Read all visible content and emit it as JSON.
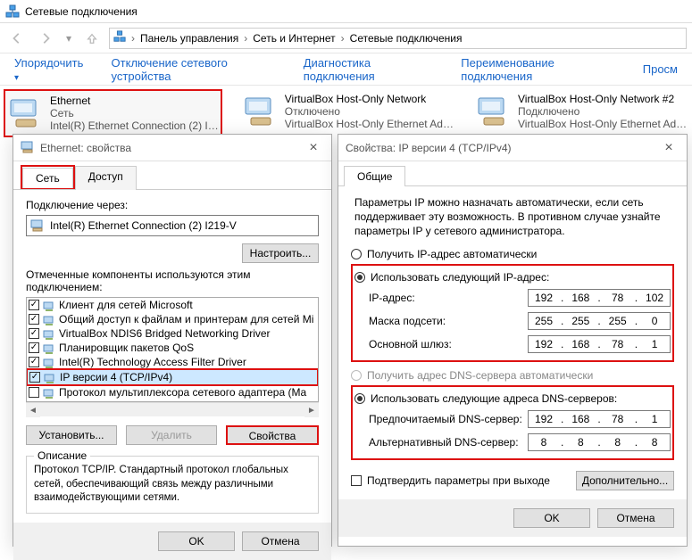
{
  "explorer": {
    "title": "Сетевые подключения",
    "breadcrumbs": [
      "Панель управления",
      "Сеть и Интернет",
      "Сетевые подключения"
    ],
    "toolbar": {
      "organize": "Упорядочить",
      "disable": "Отключение сетевого устройства",
      "diagnose": "Диагностика подключения",
      "rename": "Переименование подключения",
      "view": "Просм"
    },
    "items": [
      {
        "title": "Ethernet",
        "line1": "Сеть",
        "line2": "Intel(R) Ethernet Connection (2) I…"
      },
      {
        "title": "VirtualBox Host-Only Network",
        "line1": "Отключено",
        "line2": "VirtualBox Host-Only Ethernet Ad…"
      },
      {
        "title": "VirtualBox Host-Only Network #2",
        "line1": "Подключено",
        "line2": "VirtualBox Host-Only Ethernet Ad…"
      }
    ]
  },
  "propsDlg": {
    "title": "Ethernet: свойства",
    "tabs": {
      "network": "Сеть",
      "access": "Доступ"
    },
    "connectUsing": "Подключение через:",
    "adapter": "Intel(R) Ethernet Connection (2) I219-V",
    "configure": "Настроить...",
    "componentsHeader": "Отмеченные компоненты используются этим подключением:",
    "components": [
      {
        "checked": true,
        "label": "Клиент для сетей Microsoft"
      },
      {
        "checked": true,
        "label": "Общий доступ к файлам и принтерам для сетей Mi"
      },
      {
        "checked": true,
        "label": "VirtualBox NDIS6 Bridged Networking Driver"
      },
      {
        "checked": true,
        "label": "Планировщик пакетов QoS"
      },
      {
        "checked": true,
        "label": "Intel(R) Technology Access Filter Driver"
      },
      {
        "checked": true,
        "label": "IP версии 4 (TCP/IPv4)",
        "selected": true
      },
      {
        "checked": false,
        "label": "Протокол мультиплексора сетевого адаптера (Ma"
      }
    ],
    "install": "Установить...",
    "uninstall": "Удалить",
    "properties": "Свойства",
    "descHeader": "Описание",
    "descText": "Протокол TCP/IP. Стандартный протокол глобальных сетей, обеспечивающий связь между различными взаимодействующими сетями.",
    "ok": "OK",
    "cancel": "Отмена"
  },
  "ipv4Dlg": {
    "title": "Свойства: IP версии 4 (TCP/IPv4)",
    "tab": "Общие",
    "intro": "Параметры IP можно назначать автоматически, если сеть поддерживает эту возможность. В противном случае узнайте параметры IP у сетевого администратора.",
    "radio_auto_ip": "Получить IP-адрес автоматически",
    "radio_manual_ip": "Использовать следующий IP-адрес:",
    "ip_label": "IP-адрес:",
    "ip": [
      "192",
      "168",
      "78",
      "102"
    ],
    "mask_label": "Маска подсети:",
    "mask": [
      "255",
      "255",
      "255",
      "0"
    ],
    "gw_label": "Основной шлюз:",
    "gw": [
      "192",
      "168",
      "78",
      "1"
    ],
    "radio_auto_dns": "Получить адрес DNS-сервера автоматически",
    "radio_manual_dns": "Использовать следующие адреса DNS-серверов:",
    "dns1_label": "Предпочитаемый DNS-сервер:",
    "dns1": [
      "192",
      "168",
      "78",
      "1"
    ],
    "dns2_label": "Альтернативный DNS-сервер:",
    "dns2": [
      "8",
      "8",
      "8",
      "8"
    ],
    "validate": "Подтвердить параметры при выходе",
    "advanced": "Дополнительно...",
    "ok": "OK",
    "cancel": "Отмена"
  }
}
